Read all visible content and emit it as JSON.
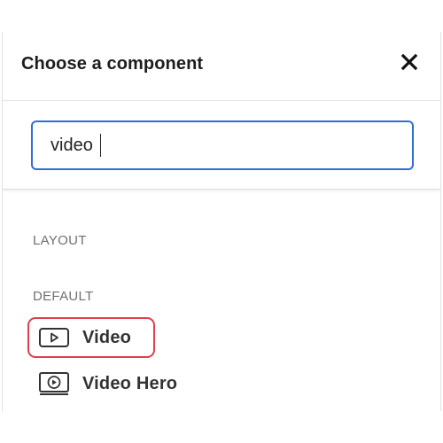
{
  "header": {
    "title": "Choose a component",
    "close_icon": "close-icon"
  },
  "search": {
    "value": "video",
    "border_color": "#2f6fd6"
  },
  "sections": [
    {
      "label": "LAYOUT",
      "items": []
    },
    {
      "label": "DEFAULT",
      "items": [
        {
          "label": "Video",
          "icon": "video-play-icon",
          "selected": true
        },
        {
          "label": "Video Hero",
          "icon": "video-hero-icon",
          "selected": false
        }
      ]
    }
  ],
  "colors": {
    "highlight": "#e03e4b",
    "text": "#333333",
    "section_label": "#707070"
  }
}
